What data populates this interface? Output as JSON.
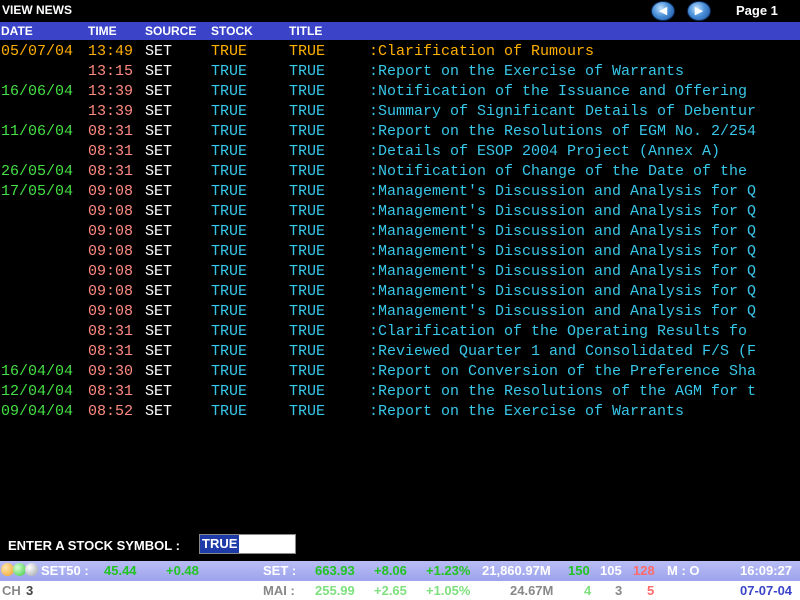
{
  "window": {
    "title": "VIEW NEWS",
    "page_label": "Page 1"
  },
  "nav": {
    "prev_glyph": "◀",
    "next_glyph": "▶"
  },
  "columns": {
    "date": "DATE",
    "time": "TIME",
    "source": "SOURCE",
    "stock": "STOCK",
    "title": "TITLE"
  },
  "news": [
    {
      "date": "05/07/04",
      "time": "13:49",
      "source": "SET",
      "stock": "TRUE",
      "title": "TRUE",
      "headline": ":Clarification of Rumours"
    },
    {
      "date": "",
      "time": "13:15",
      "source": "SET",
      "stock": "TRUE",
      "title": "TRUE",
      "headline": ":Report on the Exercise of Warrants"
    },
    {
      "date": "16/06/04",
      "time": "13:39",
      "source": "SET",
      "stock": "TRUE",
      "title": "TRUE",
      "headline": ":Notification of the Issuance and Offering"
    },
    {
      "date": "",
      "time": "13:39",
      "source": "SET",
      "stock": "TRUE",
      "title": "TRUE",
      "headline": ":Summary of Significant Details of Debentur"
    },
    {
      "date": "11/06/04",
      "time": "08:31",
      "source": "SET",
      "stock": "TRUE",
      "title": "TRUE",
      "headline": ":Report on the Resolutions of EGM No. 2/254"
    },
    {
      "date": "",
      "time": "08:31",
      "source": "SET",
      "stock": "TRUE",
      "title": "TRUE",
      "headline": ":Details of  ESOP 2004 Project (Annex A)"
    },
    {
      "date": "26/05/04",
      "time": "08:31",
      "source": "SET",
      "stock": "TRUE",
      "title": "TRUE",
      "headline": ":Notification of Change of the Date of the"
    },
    {
      "date": "17/05/04",
      "time": "09:08",
      "source": "SET",
      "stock": "TRUE",
      "title": "TRUE",
      "headline": ":Management's Discussion and Analysis for Q"
    },
    {
      "date": "",
      "time": "09:08",
      "source": "SET",
      "stock": "TRUE",
      "title": "TRUE",
      "headline": ":Management's Discussion and Analysis for Q"
    },
    {
      "date": "",
      "time": "09:08",
      "source": "SET",
      "stock": "TRUE",
      "title": "TRUE",
      "headline": ":Management's Discussion and Analysis for Q"
    },
    {
      "date": "",
      "time": "09:08",
      "source": "SET",
      "stock": "TRUE",
      "title": "TRUE",
      "headline": ":Management's Discussion and Analysis for Q"
    },
    {
      "date": "",
      "time": "09:08",
      "source": "SET",
      "stock": "TRUE",
      "title": "TRUE",
      "headline": ":Management's Discussion and Analysis for Q"
    },
    {
      "date": "",
      "time": "09:08",
      "source": "SET",
      "stock": "TRUE",
      "title": "TRUE",
      "headline": ":Management's Discussion and Analysis for Q"
    },
    {
      "date": "",
      "time": "09:08",
      "source": "SET",
      "stock": "TRUE",
      "title": "TRUE",
      "headline": ":Management's Discussion and Analysis for Q"
    },
    {
      "date": "",
      "time": "08:31",
      "source": "SET",
      "stock": "TRUE",
      "title": "TRUE",
      "headline": ":Clarification of the Operating Results  fo"
    },
    {
      "date": "",
      "time": "08:31",
      "source": "SET",
      "stock": "TRUE",
      "title": "TRUE",
      "headline": ":Reviewed Quarter 1 and Consolidated F/S (F"
    },
    {
      "date": "16/04/04",
      "time": "09:30",
      "source": "SET",
      "stock": "TRUE",
      "title": "TRUE",
      "headline": ":Report on Conversion of the Preference Sha"
    },
    {
      "date": "12/04/04",
      "time": "08:31",
      "source": "SET",
      "stock": "TRUE",
      "title": "TRUE",
      "headline": ":Report on the Resolutions of the AGM for t"
    },
    {
      "date": "09/04/04",
      "time": "08:52",
      "source": "SET",
      "stock": "TRUE",
      "title": "TRUE",
      "headline": ":Report on the Exercise of  Warrants"
    }
  ],
  "input": {
    "label": "ENTER A STOCK  SYMBOL :",
    "value": "TRUE"
  },
  "ticker": {
    "line1": {
      "set50_label": "SET50 :",
      "set50_value": "45.44",
      "set50_change": "+0.48",
      "set_label": "SET :",
      "set_value": "663.93",
      "set_change": "+8.06",
      "set_pct": "+1.23%",
      "set_volume": "21,860.97M",
      "adv": "150",
      "unch": "105",
      "dec": "128",
      "market_label": "M : O",
      "time": "16:09:27"
    },
    "line2": {
      "ch_label": "CH",
      "ch_value": "3",
      "mai_label": "MAI :",
      "mai_value": "255.99",
      "mai_change": "+2.65",
      "mai_pct": "+1.05%",
      "mai_volume": "24.67M",
      "adv": "4",
      "unch": "3",
      "dec": "5",
      "date": "07-07-04"
    }
  },
  "colors": {
    "header_bg": "#3b44c9",
    "highlight": "#ffb000",
    "date_green": "#44e044",
    "time_pink": "#ff8a80",
    "cyan": "#37c7e8",
    "ticker_bg": "#b9bdf5",
    "up_green": "#22c422",
    "down_red": "#ff6a6a"
  }
}
